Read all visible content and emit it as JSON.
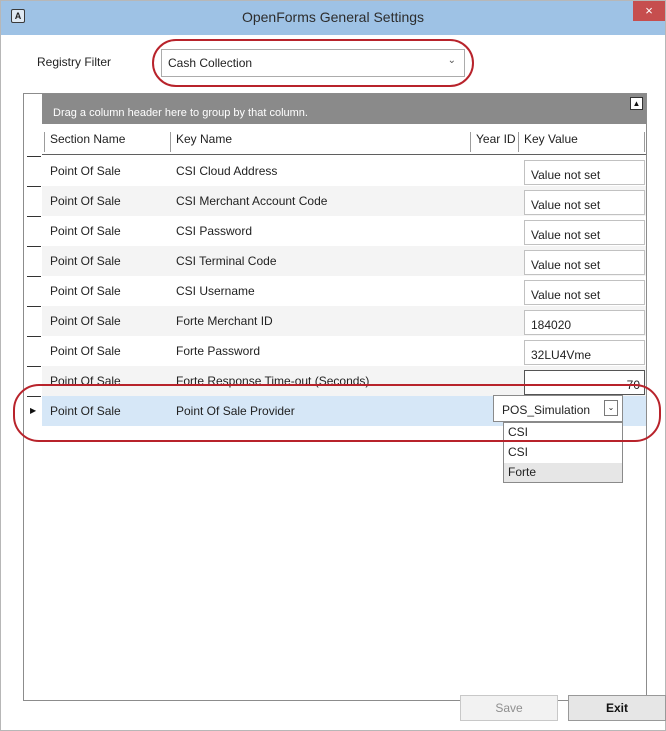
{
  "window": {
    "title": "OpenForms General Settings",
    "close_glyph": "×",
    "app_icon_glyph": "A"
  },
  "filter": {
    "label": "Registry Filter",
    "value": "Cash Collection"
  },
  "grid": {
    "group_panel_text": "Drag a column header here to group by that column.",
    "columns": [
      "Section Name",
      "Key Name",
      "Year ID",
      "Key Value"
    ],
    "rows": [
      {
        "section": "Point Of Sale",
        "key": "CSI Cloud Address",
        "year": "",
        "value": "Value not set"
      },
      {
        "section": "Point Of Sale",
        "key": "CSI Merchant Account Code",
        "year": "",
        "value": "Value not set"
      },
      {
        "section": "Point Of Sale",
        "key": "CSI Password",
        "year": "",
        "value": "Value not set"
      },
      {
        "section": "Point Of Sale",
        "key": "CSI Terminal Code",
        "year": "",
        "value": "Value not set"
      },
      {
        "section": "Point Of Sale",
        "key": "CSI Username",
        "year": "",
        "value": "Value not set"
      },
      {
        "section": "Point Of Sale",
        "key": "Forte Merchant ID",
        "year": "",
        "value": "184020"
      },
      {
        "section": "Point Of Sale",
        "key": "Forte Password",
        "year": "",
        "value": "32LU4Vme"
      },
      {
        "section": "Point Of Sale",
        "key": "Forte Response Time-out (Seconds)",
        "year": "",
        "value": "70"
      }
    ],
    "selected_row": {
      "section": "Point Of Sale",
      "key": "Point Of Sale Provider",
      "year": "",
      "value": "POS_Simulation"
    },
    "dropdown_options": [
      "CSI",
      "CSI",
      "Forte"
    ]
  },
  "footer": {
    "save_label": "Save",
    "exit_label": "Exit"
  }
}
